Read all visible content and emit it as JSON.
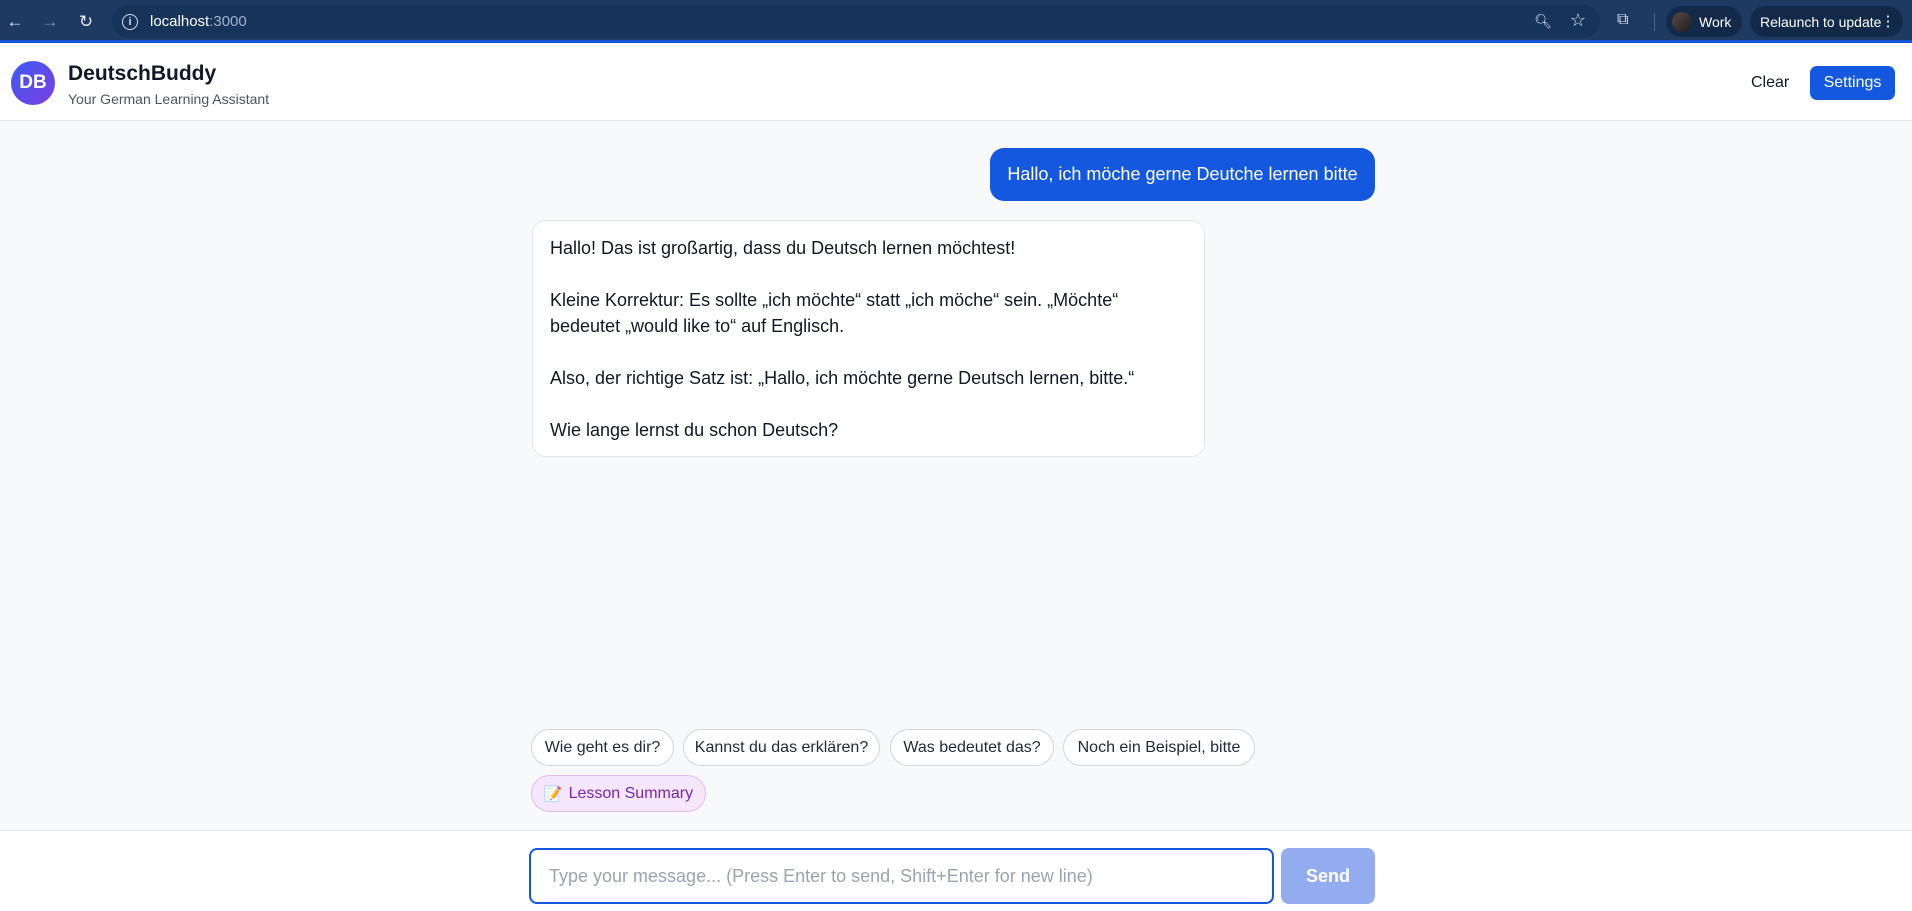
{
  "browser": {
    "url_host": "localhost",
    "url_port": ":3000",
    "profile_label": "Work",
    "relaunch_label": "Relaunch to update"
  },
  "header": {
    "logo_initials": "DB",
    "title": "DeutschBuddy",
    "subtitle": "Your German Learning Assistant",
    "clear_label": "Clear",
    "settings_label": "Settings"
  },
  "chat": {
    "user_message": "Hallo, ich möche gerne Deutche lernen bitte",
    "assistant_message": [
      "Hallo! Das ist großartig, dass du Deutsch lernen möchtest!",
      "Kleine Korrektur: Es sollte „ich möchte“ statt „ich möche“ sein. „Möchte“ bedeutet „would like to“ auf Englisch.",
      "Also, der richtige Satz ist: „Hallo, ich möchte gerne Deutsch lernen, bitte.“",
      "Wie lange lernst du schon Deutsch?"
    ]
  },
  "suggestions": {
    "items": [
      "Wie geht es dir?",
      "Kannst du das erklären?",
      "Was bedeutet das?",
      "Noch ein Beispiel, bitte"
    ],
    "summary_label": "Lesson Summary",
    "summary_icon": "📝"
  },
  "composer": {
    "placeholder": "Type your message... (Press Enter to send, Shift+Enter for new line)",
    "value": "",
    "send_label": "Send"
  },
  "colors": {
    "accent": "#1558e0",
    "send_disabled": "#93acf0",
    "summary_bg": "#f6e6fb",
    "summary_text": "#7a26a8",
    "chrome_bg": "#1d3a63"
  }
}
